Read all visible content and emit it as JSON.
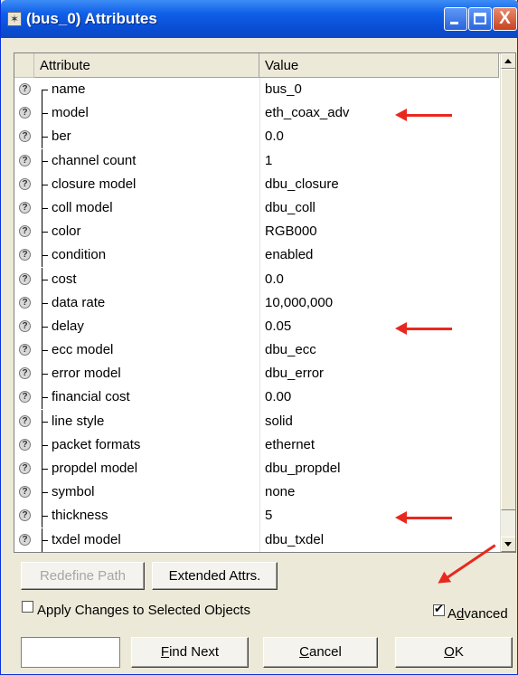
{
  "window": {
    "title": "(bus_0) Attributes",
    "close_glyph": "X"
  },
  "table": {
    "headers": [
      "Attribute",
      "Value"
    ],
    "rows": [
      {
        "name": "name",
        "value": "bus_0"
      },
      {
        "name": "model",
        "value": "eth_coax_adv"
      },
      {
        "name": "ber",
        "value": "0.0"
      },
      {
        "name": "channel count",
        "value": "1"
      },
      {
        "name": "closure model",
        "value": "dbu_closure"
      },
      {
        "name": "coll model",
        "value": "dbu_coll"
      },
      {
        "name": "color",
        "value": "RGB000"
      },
      {
        "name": "condition",
        "value": "enabled"
      },
      {
        "name": "cost",
        "value": "0.0"
      },
      {
        "name": "data rate",
        "value": "10,000,000"
      },
      {
        "name": "delay",
        "value": "0.05"
      },
      {
        "name": "ecc model",
        "value": "dbu_ecc"
      },
      {
        "name": "error model",
        "value": "dbu_error"
      },
      {
        "name": "financial cost",
        "value": "0.00"
      },
      {
        "name": "line style",
        "value": "solid"
      },
      {
        "name": "packet formats",
        "value": "ethernet"
      },
      {
        "name": "propdel model",
        "value": "dbu_propdel"
      },
      {
        "name": "symbol",
        "value": "none"
      },
      {
        "name": "thickness",
        "value": "5"
      },
      {
        "name": "txdel model",
        "value": "dbu_txdel"
      }
    ]
  },
  "buttons": {
    "redefine_path": "Redefine Path",
    "extended_attrs": "Extended Attrs.",
    "find_next_u": "F",
    "find_next_rest": "ind Next",
    "cancel_u": "C",
    "cancel_rest": "ancel",
    "ok_u": "O",
    "ok_rest": "K"
  },
  "options": {
    "apply_label": "Apply Changes to Selected Objects",
    "apply_checked": false,
    "advanced_pre": "A",
    "advanced_u": "d",
    "advanced_rest": "vanced",
    "advanced_checked": true
  },
  "find": {
    "value": ""
  },
  "colors": {
    "titlebar": "#0a4fd6",
    "annotation_arrow": "#e8281e",
    "dialog_bg": "#ece9d8"
  }
}
